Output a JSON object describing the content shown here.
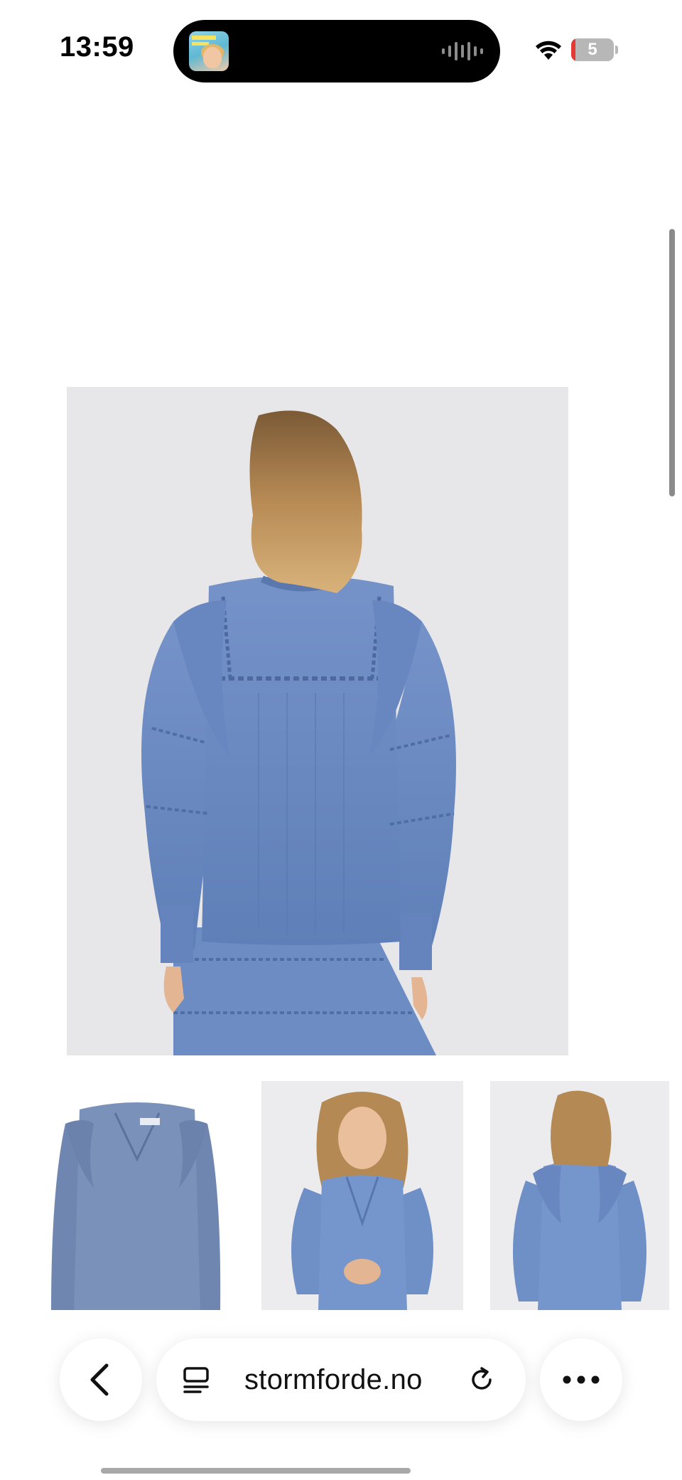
{
  "status_bar": {
    "time": "13:59",
    "battery_level": "5",
    "battery_fraction": 0.05,
    "now_playing_icon": "podcast-artwork-icon",
    "activity_icon": "waveform-icon",
    "wifi_icon": "wifi-icon"
  },
  "product_gallery": {
    "main_image_alt": "blouse-back-view-model",
    "thumbnails": [
      "blouse-flat-lay",
      "blouse-front-view-model",
      "blouse-back-view-model"
    ],
    "fabric_color": "#6b8cc4"
  },
  "browser_toolbar": {
    "back_icon": "chevron-left-icon",
    "reader_icon": "reader-mode-icon",
    "url": "stormforde.no",
    "reload_icon": "reload-icon",
    "more_icon": "ellipsis-icon"
  }
}
